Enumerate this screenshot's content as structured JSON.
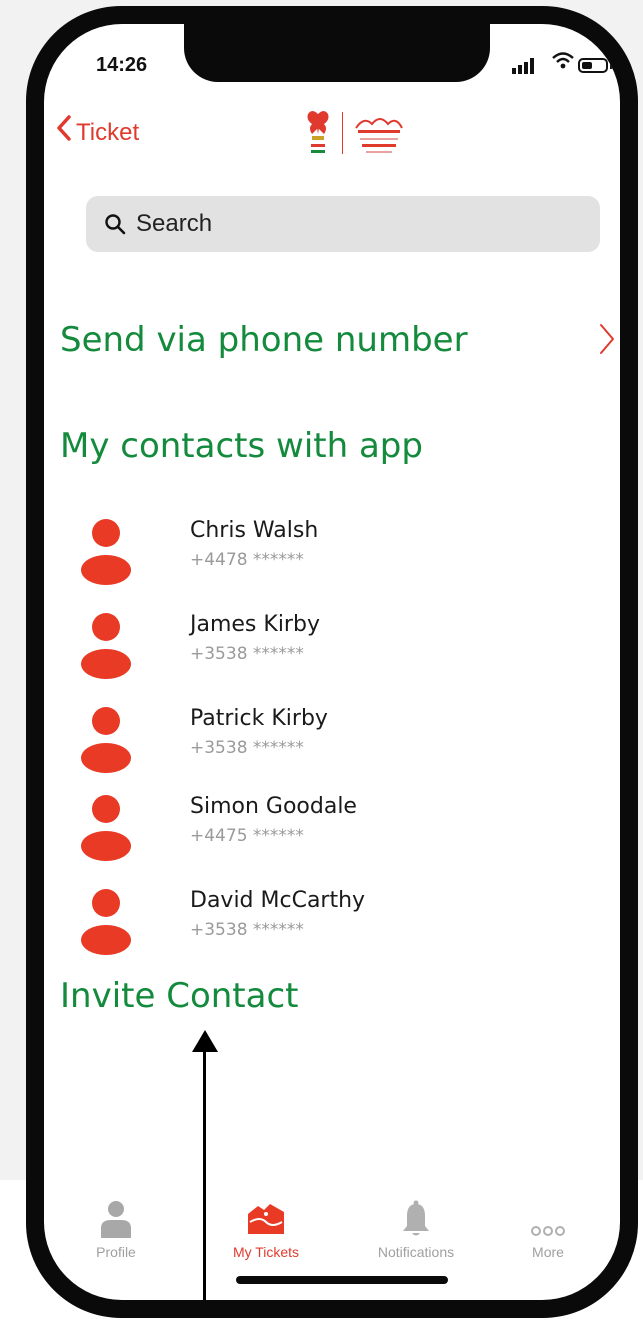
{
  "status": {
    "time": "14:26"
  },
  "nav": {
    "back_label": "Ticket"
  },
  "search": {
    "placeholder": "Search"
  },
  "send_via_phone": {
    "label": "Send via phone number"
  },
  "contacts": {
    "title": "My contacts with app",
    "items": [
      {
        "name": "Chris Walsh",
        "phone": "+4478 ******"
      },
      {
        "name": "James Kirby",
        "phone": "+3538 ******"
      },
      {
        "name": "Patrick Kirby",
        "phone": "+3538 ******"
      },
      {
        "name": "Simon Goodale",
        "phone": "+4475 ******"
      },
      {
        "name": "David McCarthy",
        "phone": "+3538 ******"
      }
    ]
  },
  "invite": {
    "label": "Invite Contact"
  },
  "tabs": [
    {
      "label": "Profile",
      "icon": "person-icon",
      "active": false
    },
    {
      "label": "My Tickets",
      "icon": "ticket-icon",
      "active": true
    },
    {
      "label": "Notifications",
      "icon": "bell-icon",
      "active": false
    },
    {
      "label": "More",
      "icon": "more-icon",
      "active": false
    }
  ],
  "colors": {
    "accent": "#e03a2e",
    "green": "#138a3c",
    "muted": "#a0a0a0"
  }
}
